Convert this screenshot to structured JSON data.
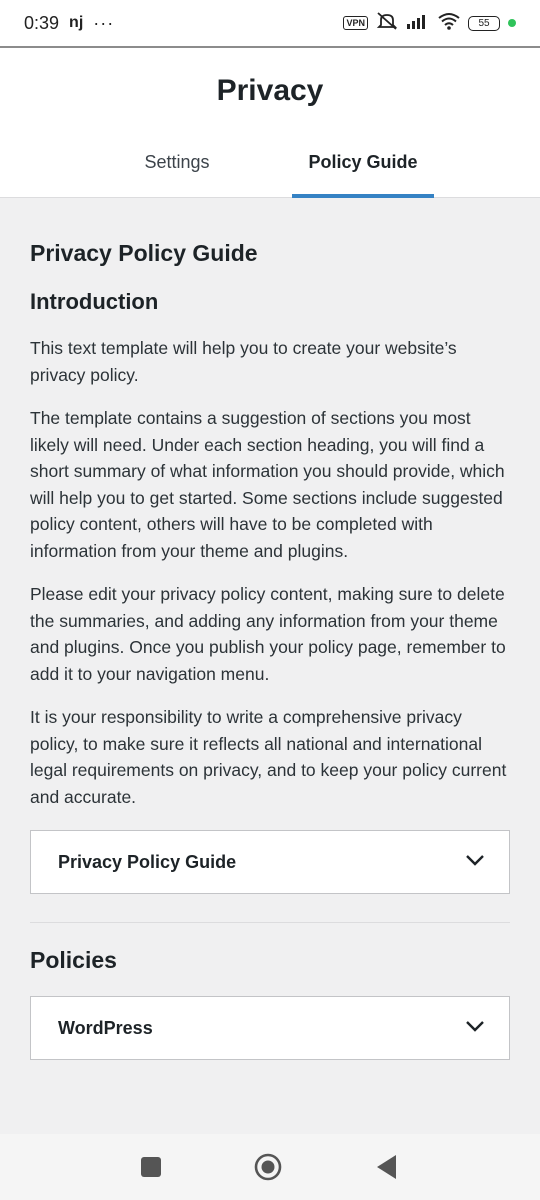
{
  "status_bar": {
    "time": "0:39",
    "carrier_badge": "nj",
    "overflow": "···",
    "vpn_label": "VPN",
    "battery": "55"
  },
  "header": {
    "title": "Privacy",
    "tabs": [
      {
        "label": "Settings",
        "active": false
      },
      {
        "label": "Policy Guide",
        "active": true
      }
    ]
  },
  "content": {
    "guide_heading": "Privacy Policy Guide",
    "intro_heading": "Introduction",
    "paragraphs": [
      "This text template will help you to create your website’s privacy policy.",
      "The template contains a suggestion of sections you most likely will need. Under each section heading, you will find a short summary of what information you should provide, which will help you to get started. Some sections include suggested policy content, others will have to be completed with information from your theme and plugins.",
      "Please edit your privacy policy content, making sure to delete the summaries, and adding any information from your theme and plugins. Once you publish your policy page, remember to add it to your navigation menu.",
      "It is your responsibility to write a comprehensive privacy policy, to make sure it reflects all national and international legal requirements on privacy, and to keep your policy current and accurate."
    ],
    "guide_accordion_label": "Privacy Policy Guide",
    "policies_heading": "Policies",
    "policies_accordion_label": "WordPress"
  },
  "colors": {
    "accent": "#3582c4",
    "background": "#f0f0f1",
    "text": "#1d2327"
  },
  "icons": {
    "accordion": "chevron-down-icon",
    "nav": [
      "recent-apps-icon",
      "home-icon",
      "back-icon"
    ]
  }
}
